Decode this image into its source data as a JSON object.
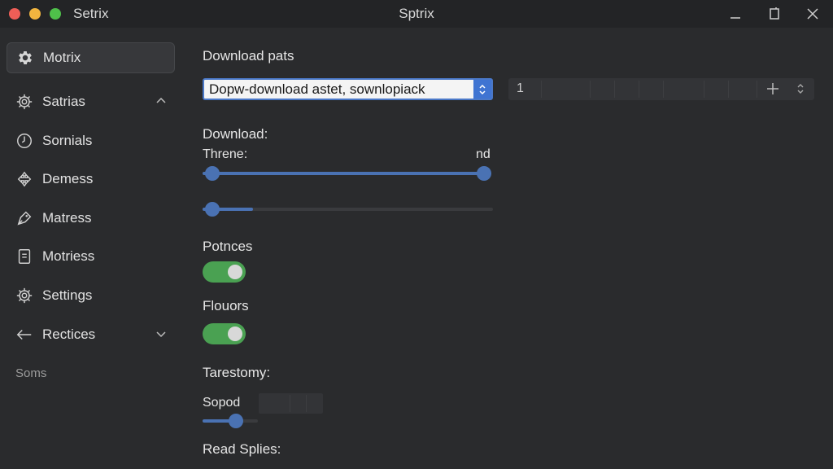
{
  "window": {
    "app_name": "Setrix",
    "title": "Sptrix"
  },
  "sidebar": {
    "items": [
      {
        "label": "Motrix",
        "icon": "gear-icon",
        "active": true
      },
      {
        "label": "Satrias",
        "icon": "gear-outline-icon",
        "chevron": "chevron-up-icon"
      },
      {
        "label": "Sornials",
        "icon": "clock-icon"
      },
      {
        "label": "Demess",
        "icon": "puzzle-icon"
      },
      {
        "label": "Matress",
        "icon": "tag-icon"
      },
      {
        "label": "Motriess",
        "icon": "document-icon"
      },
      {
        "label": "Settings",
        "icon": "gear-outline-icon"
      },
      {
        "label": "Rectices",
        "icon": "arrow-left-icon",
        "chevron": "chevron-down-icon"
      }
    ],
    "section_label": "Soms"
  },
  "main": {
    "download_path": {
      "heading": "Download pats",
      "select_value": "Dopw-download astet, sownlopiack",
      "number_value": "1"
    },
    "download": {
      "heading": "Download:",
      "slider_label_left": "Threne:",
      "slider_label_right": "nd",
      "range_slider_value": 1.0,
      "second_slider_value": 0.15
    },
    "potnces": {
      "heading": "Potnces",
      "enabled": true
    },
    "flouors": {
      "heading": "Flouors",
      "enabled": true
    },
    "tarestomy": {
      "heading": "Tarestomy:"
    },
    "sopod": {
      "label": "Sopod",
      "slider_value": 0.6
    },
    "read_splies": {
      "heading": "Read Splies:"
    }
  },
  "colors": {
    "accent": "#4a72b3",
    "toggle_on": "#4aa152",
    "background": "#2a2b2d",
    "titlebar": "#232426"
  }
}
